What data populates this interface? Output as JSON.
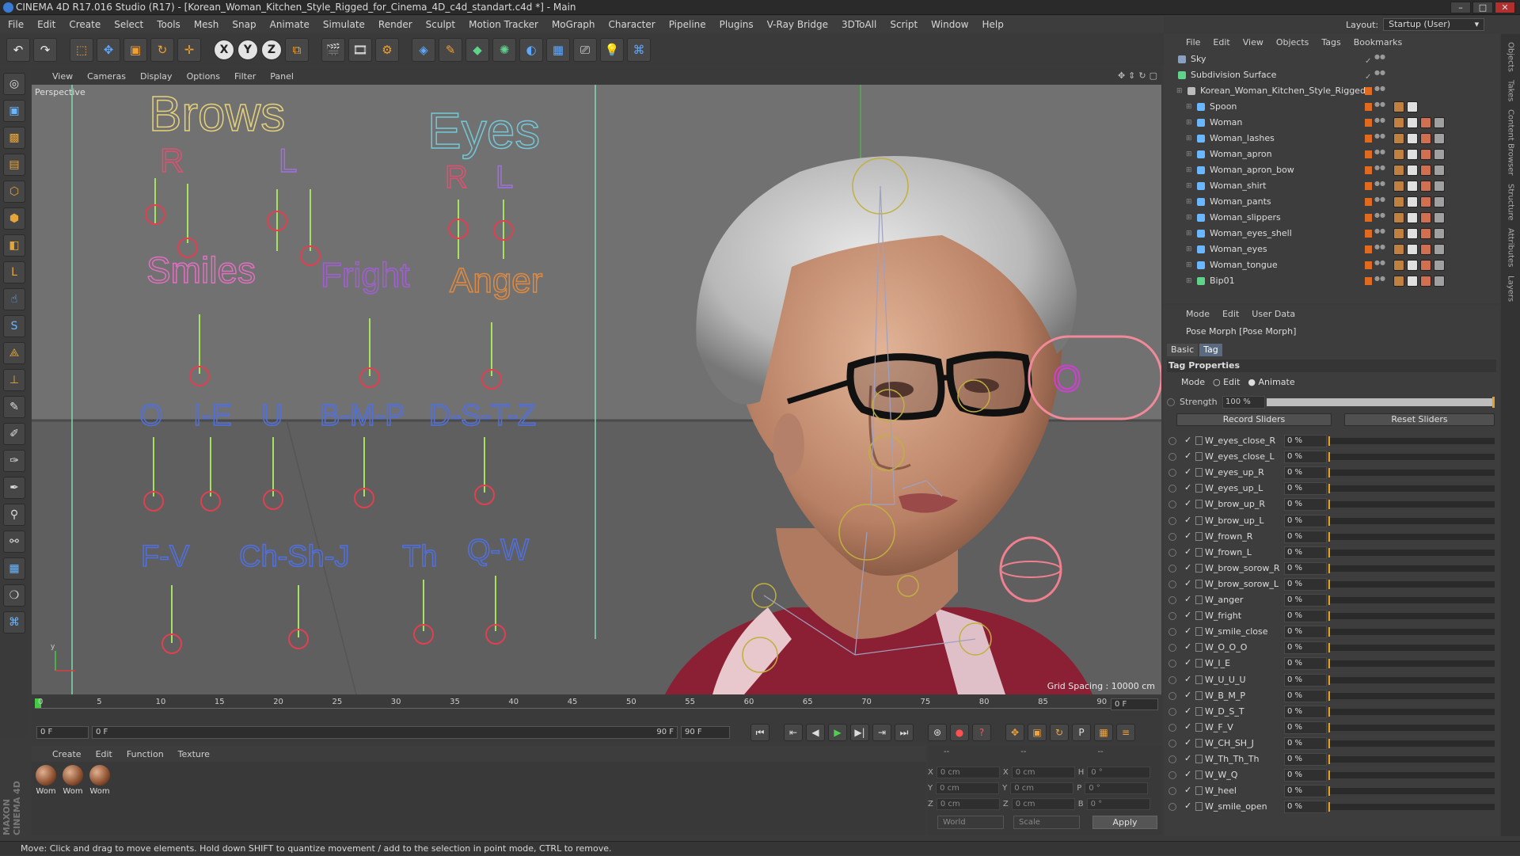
{
  "window": {
    "title": "CINEMA 4D R17.016 Studio (R17) - [Korean_Woman_Kitchen_Style_Rigged_for_Cinema_4D_c4d_standart.c4d *] - Main",
    "controls": [
      "–",
      "□",
      "✕"
    ]
  },
  "menu": [
    "File",
    "Edit",
    "Create",
    "Select",
    "Tools",
    "Mesh",
    "Snap",
    "Animate",
    "Simulate",
    "Render",
    "Sculpt",
    "Motion Tracker",
    "MoGraph",
    "Character",
    "Pipeline",
    "Plugins",
    "V-Ray Bridge",
    "3DToAll",
    "Script",
    "Window",
    "Help"
  ],
  "layout": {
    "label": "Layout:",
    "value": "Startup (User)"
  },
  "viewport": {
    "menu": [
      "View",
      "Cameras",
      "Display",
      "Options",
      "Filter",
      "Panel"
    ],
    "label": "Perspective",
    "grid_spacing": "Grid Spacing : 10000 cm",
    "rig_labels": {
      "brows": "Brows",
      "eyes": "Eyes",
      "r1": "R",
      "l1": "L",
      "r2": "R",
      "l2": "L",
      "smiles": "Smiles",
      "fright": "Fright",
      "anger": "Anger",
      "o": "O",
      "ie": "I-E",
      "u": "U",
      "bmp": "B-M-P",
      "dstz": "D-S-T-Z",
      "fv": "F-V",
      "chshj": "Ch-Sh-J",
      "th": "Th",
      "qw": "Q-W",
      "o2": "O"
    }
  },
  "timeline": {
    "ticks": [
      "0",
      "5",
      "10",
      "15",
      "20",
      "25",
      "30",
      "35",
      "40",
      "45",
      "50",
      "55",
      "60",
      "65",
      "70",
      "75",
      "80",
      "85",
      "90"
    ],
    "current_frame": "0 F"
  },
  "transport": {
    "start": "0 F",
    "range_start": "0 F",
    "range_end": "90 F",
    "end": "90 F"
  },
  "materials": {
    "menu": [
      "Create",
      "Edit",
      "Function",
      "Texture"
    ],
    "items": [
      "Wom",
      "Wom",
      "Wom"
    ]
  },
  "coords": {
    "rows": [
      {
        "a": "X",
        "av": "0 cm",
        "b": "X",
        "bv": "0 cm",
        "c": "H",
        "cv": "0 °"
      },
      {
        "a": "Y",
        "av": "0 cm",
        "b": "Y",
        "bv": "0 cm",
        "c": "P",
        "cv": "0 °"
      },
      {
        "a": "Z",
        "av": "0 cm",
        "b": "Z",
        "bv": "0 cm",
        "c": "B",
        "cv": "0 °"
      }
    ],
    "headers": [
      "--",
      "--",
      "--"
    ],
    "world": "World",
    "scale": "Scale",
    "apply": "Apply"
  },
  "status": "Move: Click and drag to move elements. Hold down SHIFT to quantize movement / add to the selection in point mode, CTRL to remove.",
  "objects": {
    "menu": [
      "File",
      "Edit",
      "View",
      "Objects",
      "Tags",
      "Bookmarks"
    ],
    "items": [
      {
        "name": "Sky",
        "indent": 0,
        "icon": "#8aa0c0",
        "layer": false
      },
      {
        "name": "Subdivision Surface",
        "indent": 0,
        "icon": "#5fd38a",
        "layer": false
      },
      {
        "name": "Korean_Woman_Kitchen_Style_Rigged",
        "indent": 1,
        "icon": "#bbbbbb",
        "layer": true
      },
      {
        "name": "Spoon",
        "indent": 2,
        "icon": "#6ab6ff",
        "layer": true
      },
      {
        "name": "Woman",
        "indent": 2,
        "icon": "#6ab6ff",
        "layer": true
      },
      {
        "name": "Woman_lashes",
        "indent": 2,
        "icon": "#6ab6ff",
        "layer": true
      },
      {
        "name": "Woman_apron",
        "indent": 2,
        "icon": "#6ab6ff",
        "layer": true
      },
      {
        "name": "Woman_apron_bow",
        "indent": 2,
        "icon": "#6ab6ff",
        "layer": true
      },
      {
        "name": "Woman_shirt",
        "indent": 2,
        "icon": "#6ab6ff",
        "layer": true
      },
      {
        "name": "Woman_pants",
        "indent": 2,
        "icon": "#6ab6ff",
        "layer": true
      },
      {
        "name": "Woman_slippers",
        "indent": 2,
        "icon": "#6ab6ff",
        "layer": true
      },
      {
        "name": "Woman_eyes_shell",
        "indent": 2,
        "icon": "#6ab6ff",
        "layer": true
      },
      {
        "name": "Woman_eyes",
        "indent": 2,
        "icon": "#6ab6ff",
        "layer": true
      },
      {
        "name": "Woman_tongue",
        "indent": 2,
        "icon": "#6ab6ff",
        "layer": true
      },
      {
        "name": "Bip01",
        "indent": 2,
        "icon": "#5fd38a",
        "layer": true
      }
    ]
  },
  "attributes": {
    "menu": [
      "Mode",
      "Edit",
      "User Data"
    ],
    "title": "Pose Morph [Pose Morph]",
    "tabs": [
      "Basic",
      "Tag"
    ],
    "section": "Tag Properties",
    "mode_label": "Mode",
    "mode_edit": "Edit",
    "mode_animate": "Animate",
    "strength_label": "Strength",
    "strength_value": "100 %",
    "record": "Record Sliders",
    "reset": "Reset Sliders",
    "sliders": [
      {
        "name": "W_eyes_close_R",
        "value": "0 %"
      },
      {
        "name": "W_eyes_close_L",
        "value": "0 %"
      },
      {
        "name": "W_eyes_up_R",
        "value": "0 %"
      },
      {
        "name": "W_eyes_up_L",
        "value": "0 %"
      },
      {
        "name": "W_brow_up_R",
        "value": "0 %"
      },
      {
        "name": "W_brow_up_L",
        "value": "0 %"
      },
      {
        "name": "W_frown_R",
        "value": "0 %"
      },
      {
        "name": "W_frown_L",
        "value": "0 %"
      },
      {
        "name": "W_brow_sorow_R",
        "value": "0 %"
      },
      {
        "name": "W_brow_sorow_L",
        "value": "0 %"
      },
      {
        "name": "W_anger",
        "value": "0 %"
      },
      {
        "name": "W_fright",
        "value": "0 %"
      },
      {
        "name": "W_smile_close",
        "value": "0 %"
      },
      {
        "name": "W_O_O_O",
        "value": "0 %"
      },
      {
        "name": "W_I_E",
        "value": "0 %"
      },
      {
        "name": "W_U_U_U",
        "value": "0 %"
      },
      {
        "name": "W_B_M_P",
        "value": "0 %"
      },
      {
        "name": "W_D_S_T",
        "value": "0 %"
      },
      {
        "name": "W_F_V",
        "value": "0 %"
      },
      {
        "name": "W_CH_SH_J",
        "value": "0 %"
      },
      {
        "name": "W_Th_Th_Th",
        "value": "0 %"
      },
      {
        "name": "W_W_Q",
        "value": "0 %"
      },
      {
        "name": "W_heel",
        "value": "0 %"
      },
      {
        "name": "W_smile_open",
        "value": "0 %"
      }
    ]
  },
  "side_tabs": [
    "Objects",
    "Takes",
    "Content Browser",
    "Structure",
    "Attributes",
    "Layers"
  ]
}
